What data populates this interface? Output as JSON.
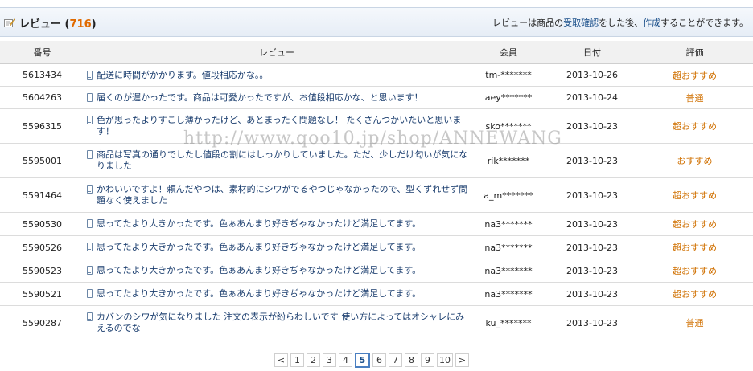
{
  "header": {
    "title": "レビュー",
    "count_open": " (",
    "count": "716",
    "count_close": ")",
    "note_before": "レビューは商品の",
    "note_link1": "受取確認",
    "note_mid": "をした後、",
    "note_link2": "作成",
    "note_after": "することができます。"
  },
  "columns": {
    "no": "番号",
    "review": "レビュー",
    "member": "会員",
    "date": "日付",
    "rating": "評価"
  },
  "rows": [
    {
      "no": "5613434",
      "text": "配送に時間がかかります。値段相応かな。。",
      "member": "tm-*******",
      "date": "2013-10-26",
      "rating": "超おすすめ"
    },
    {
      "no": "5604263",
      "text": "届くのが遅かったです。商品は可愛かったですが、お値段相応かな、と思います！",
      "member": "aey*******",
      "date": "2013-10-24",
      "rating": "普通"
    },
    {
      "no": "5596315",
      "text": "色が思ったよりすこし薄かったけど、あとまったく問題なし！ たくさんつかいたいと思います！",
      "member": "sko*******",
      "date": "2013-10-23",
      "rating": "超おすすめ"
    },
    {
      "no": "5595001",
      "text": "商品は写真の通りでしたし値段の割にはしっかりしていました。ただ、少しだけ匂いが気になりました",
      "member": "rik*******",
      "date": "2013-10-23",
      "rating": "おすすめ"
    },
    {
      "no": "5591464",
      "text": "かわいいですよ！頼んだやつは、素材的にシワがでるやつじゃなかったので、型くずれせず問題なく使えました",
      "member": "a_m*******",
      "date": "2013-10-23",
      "rating": "超おすすめ"
    },
    {
      "no": "5590530",
      "text": "思ってたより大きかったです。色ぁあんまり好きぢゃなかったけど満足してます。",
      "member": "na3*******",
      "date": "2013-10-23",
      "rating": "超おすすめ"
    },
    {
      "no": "5590526",
      "text": "思ってたより大きかったです。色ぁあんまり好きぢゃなかったけど満足してます。",
      "member": "na3*******",
      "date": "2013-10-23",
      "rating": "超おすすめ"
    },
    {
      "no": "5590523",
      "text": "思ってたより大きかったです。色ぁあんまり好きぢゃなかったけど満足してます。",
      "member": "na3*******",
      "date": "2013-10-23",
      "rating": "超おすすめ"
    },
    {
      "no": "5590521",
      "text": "思ってたより大きかったです。色ぁあんまり好きぢゃなかったけど満足してます。",
      "member": "na3*******",
      "date": "2013-10-23",
      "rating": "超おすすめ"
    },
    {
      "no": "5590287",
      "text": "カバンのシワが気になりました 注文の表示が紛らわしいです 使い方によってはオシャレにみえるのでな",
      "member": "ku_*******",
      "date": "2013-10-23",
      "rating": "普通"
    }
  ],
  "watermark": "http://www.qoo10.jp/shop/ANNEWANG",
  "pagination": {
    "prev": "<",
    "pages": [
      "1",
      "2",
      "3",
      "4",
      "5",
      "6",
      "7",
      "8",
      "9",
      "10"
    ],
    "current": "5",
    "next": ">"
  },
  "colors": {
    "accent_orange": "#d07000",
    "link_blue": "#1a3d6e",
    "header_bg": "#e6edf6"
  }
}
